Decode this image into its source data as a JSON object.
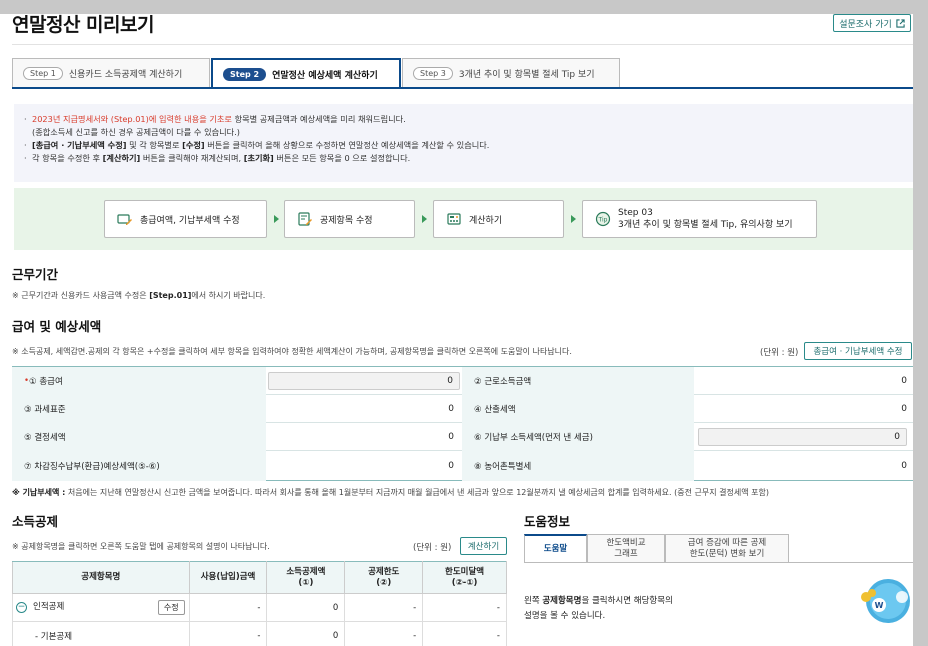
{
  "header": {
    "title": "연말정산 미리보기",
    "survey_label": "설문조사 가기"
  },
  "tabs": [
    {
      "step": "Step 1",
      "label": "신용카드 소득공제액 계산하기"
    },
    {
      "step": "Step 2",
      "label": "연말정산 예상세액 계산하기"
    },
    {
      "step": "Step 3",
      "label": "3개년 추이 및 항목별 절세 Tip 보기"
    }
  ],
  "notice": {
    "line1_red": "2023년 지급명세서와 (Step.01)에 입력한 내용을 기초로",
    "line1_rest": " 항목별 공제금액과 예상세액을 미리 채워드립니다.",
    "line2": "(종합소득세 신고를 하신 경우 공제금액이 다를 수 있습니다.)",
    "line3_bold": "[총급여 · 기납부세액 수정]",
    "line3_mid": " 및 각 항목별로 ",
    "line3_bold2": "[수정]",
    "line3_rest": " 버튼을 클릭하여 올해 상황으로 수정하면 연말정산 예상세액을 계산할 수 있습니다.",
    "line4_a": "각 항목을 수정한 후 ",
    "line4_bold": "[계산하기]",
    "line4_b": " 버튼을 클릭해야 재계산되며, ",
    "line4_bold2": "[초기화]",
    "line4_c": " 버튼은 모든 항목을 0 으로 설정합니다."
  },
  "flow": [
    {
      "label": "총급여액, 기납부세액 수정",
      "icon": "edit-money-icon"
    },
    {
      "label": "공제항목 수정",
      "icon": "edit-doc-icon"
    },
    {
      "label": "계산하기",
      "icon": "calculator-icon"
    },
    {
      "label": "Step 03",
      "sub": "3개년 추이 및 항목별 절세 Tip, 유의사항 보기",
      "icon": "tip-icon"
    }
  ],
  "work": {
    "title": "근무기간",
    "note_a": "※ 근무기간과 신용카드 사용금액 수정은 ",
    "note_bold": "[Step.01]",
    "note_b": "에서 하시기 바랍니다."
  },
  "salary": {
    "title": "급여 및 예상세액",
    "note": "※ 소득공제, 세액감면.공제의 각 항목은 +수정을 클릭하여 세부 항목을 입력하여야 정확한 세액계산이 가능하며, 공제항목명을 클릭하면 오른쪽에 도움말이 나타납니다.",
    "unit": "(단위 : 원)",
    "edit_button": "총급여 · 기납부세액 수정",
    "rows": [
      {
        "left_label": "① 총급여",
        "left_value": "0",
        "right_label": "② 근로소득금액",
        "right_value": "0"
      },
      {
        "left_label": "③ 과세표준",
        "left_value": "0",
        "right_label": "④ 산출세액",
        "right_value": "0"
      },
      {
        "left_label": "⑤ 결정세액",
        "left_value": "0",
        "right_label": "⑥ 기납부 소득세액(먼저 낸 세금)",
        "right_value": "0"
      },
      {
        "left_label": "⑦ 차감징수납부(환급)예상세액(⑤-⑥)",
        "left_value": "0",
        "right_label": "⑧ 농어촌특별세",
        "right_value": "0"
      }
    ],
    "footnote_bold": "※ 기납부세액 :",
    "footnote": " 처음에는 지난해 연말정산시 신고한 금액을 보여줍니다. 따라서 회사를 통해 올해 1월분부터 지금까지 매월 월급에서 낸 세금과 앞으로 12월분까지 낼 예상세금의 합계를 입력하세요. (중전 근무지 결정세액 포함)"
  },
  "deduction": {
    "title": "소득공제",
    "note": "※ 공제항목명을 클릭하면 오른쪽 도움말 탭에 공제항목의 설명이 나타납니다.",
    "unit": "(단위 : 원)",
    "calc_button": "계산하기",
    "headers": [
      "공제항목명",
      "사용(납입)금액",
      "소득공제액\n(①)",
      "공제한도\n(②)",
      "한도미달액\n(②-①)"
    ],
    "rows": [
      {
        "name": "인적공제",
        "edit": "수정",
        "used": "-",
        "deduct": "0",
        "limit": "-",
        "short": "-"
      },
      {
        "name": "- 기본공제",
        "edit": "",
        "used": "-",
        "deduct": "0",
        "limit": "-",
        "short": "-"
      }
    ]
  },
  "help": {
    "title": "도움정보",
    "tabs": [
      "도움말",
      "한도액비교\n그래프",
      "급여 증감에 따른 공제\n한도(문턱) 변화 보기"
    ],
    "text_a": "왼쪽 ",
    "text_bold": "공제항목명",
    "text_b": "을 클릭하시면 해당항목의",
    "text_line2": "설명을 볼 수 있습니다."
  }
}
